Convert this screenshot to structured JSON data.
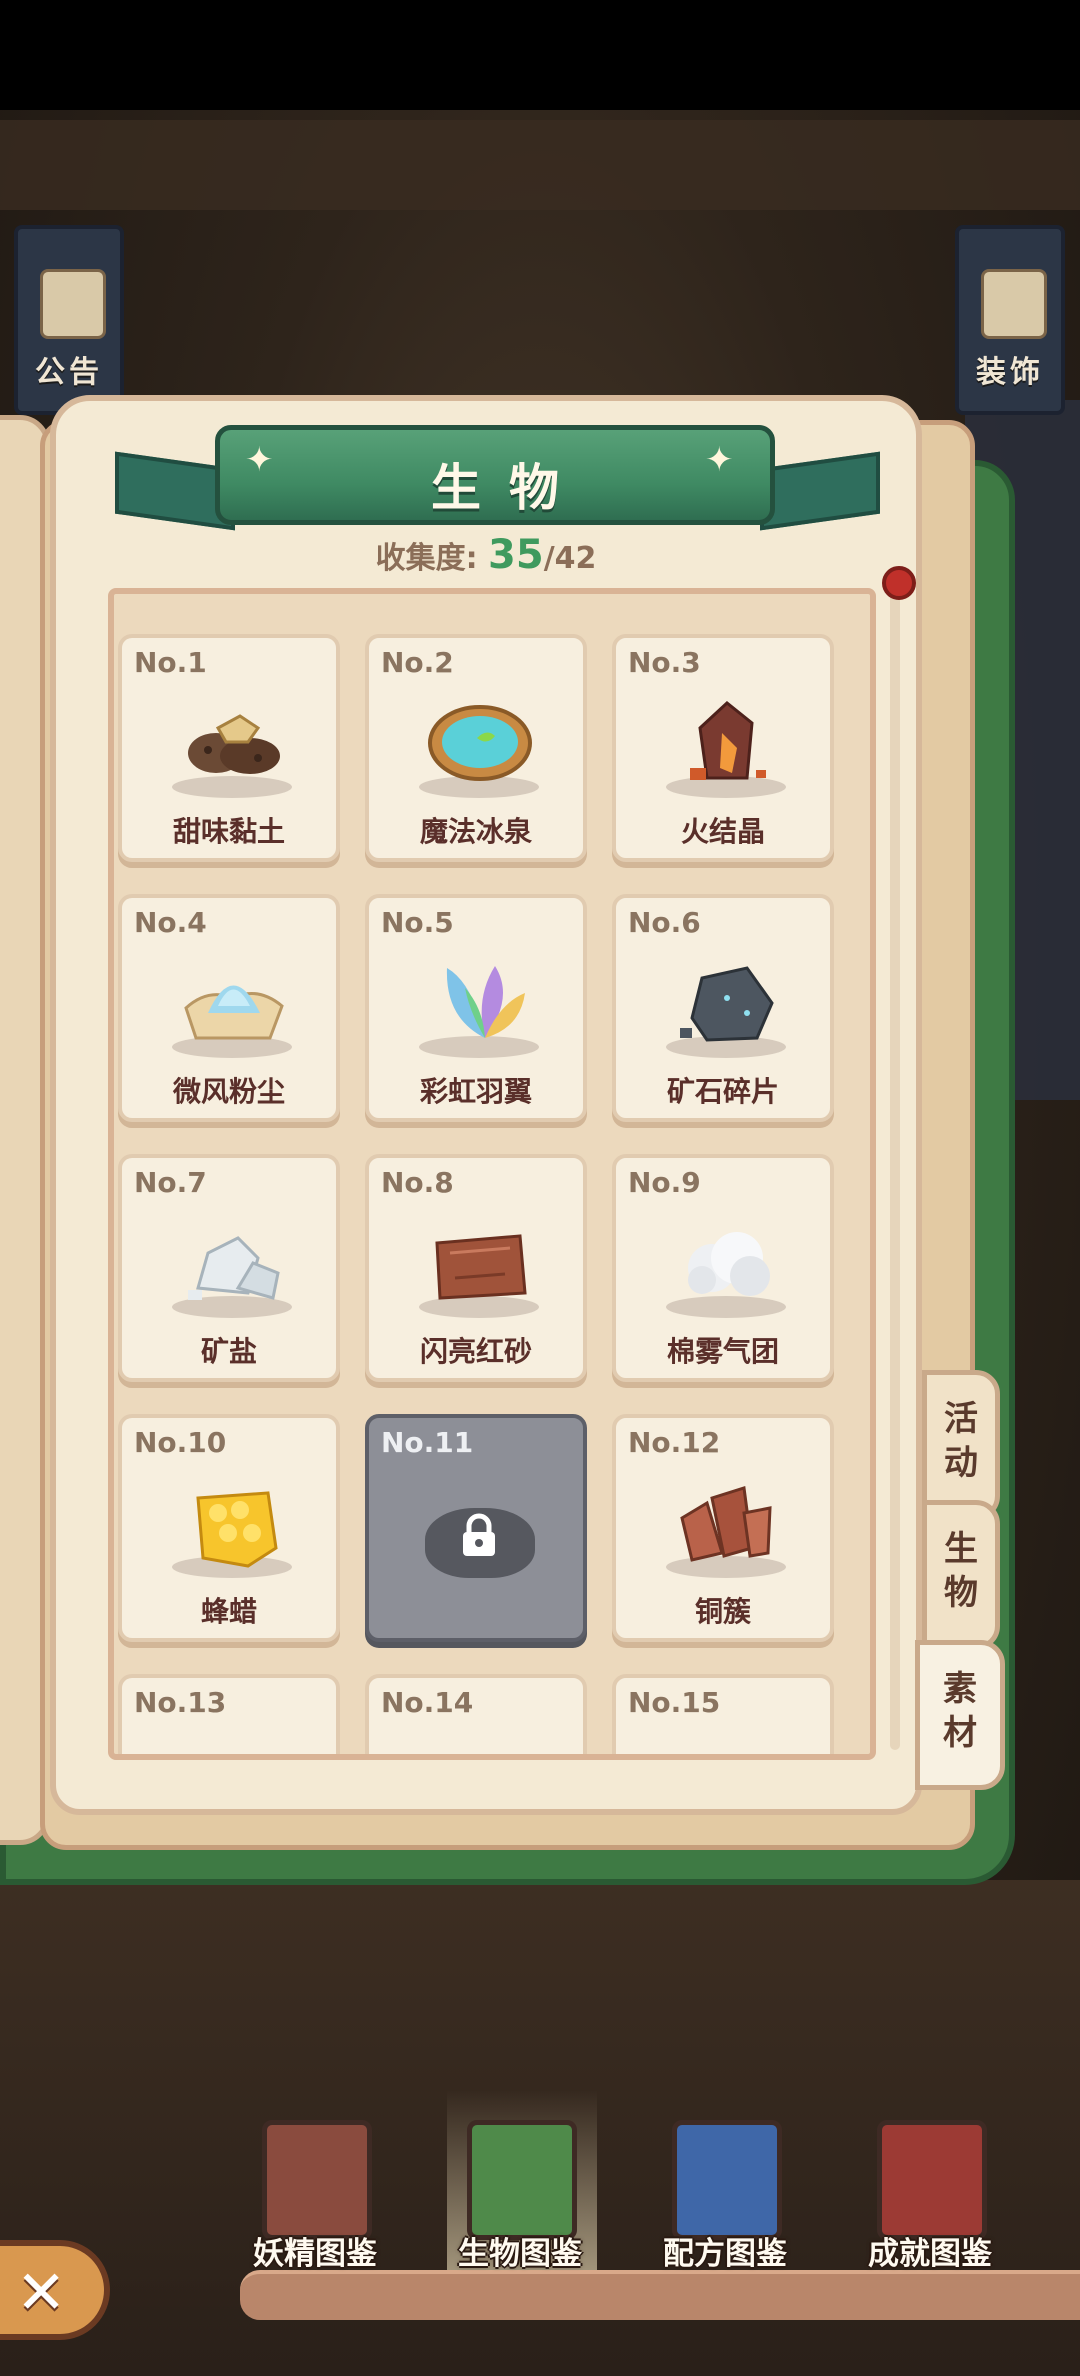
{
  "side_banners": {
    "left_label": "公告",
    "right_label": "装饰"
  },
  "book": {
    "title": "生物",
    "collection": {
      "label": "收集度:",
      "current": "35",
      "total": "/42"
    }
  },
  "cards": [
    {
      "no": "No.1",
      "name": "甜味黏土",
      "icon": "clay-lumps",
      "locked": false
    },
    {
      "no": "No.2",
      "name": "魔法冰泉",
      "icon": "magic-spring-bowl",
      "locked": false
    },
    {
      "no": "No.3",
      "name": "火结晶",
      "icon": "fire-crystal",
      "locked": false
    },
    {
      "no": "No.4",
      "name": "微风粉尘",
      "icon": "breeze-dust",
      "locked": false
    },
    {
      "no": "No.5",
      "name": "彩虹羽翼",
      "icon": "rainbow-wing",
      "locked": false
    },
    {
      "no": "No.6",
      "name": "矿石碎片",
      "icon": "ore-fragment",
      "locked": false
    },
    {
      "no": "No.7",
      "name": "矿盐",
      "icon": "rock-salt",
      "locked": false
    },
    {
      "no": "No.8",
      "name": "闪亮红砂",
      "icon": "red-sand-block",
      "locked": false
    },
    {
      "no": "No.9",
      "name": "棉雾气团",
      "icon": "cotton-cloud",
      "locked": false
    },
    {
      "no": "No.10",
      "name": "蜂蜡",
      "icon": "honeycomb",
      "locked": false
    },
    {
      "no": "No.11",
      "name": "",
      "icon": "lock",
      "locked": true
    },
    {
      "no": "No.12",
      "name": "铜簇",
      "icon": "copper-cluster",
      "locked": false
    },
    {
      "no": "No.13",
      "name": "",
      "icon": "partial",
      "locked": false
    },
    {
      "no": "No.14",
      "name": "",
      "icon": "partial",
      "locked": false
    },
    {
      "no": "No.15",
      "name": "",
      "icon": "partial",
      "locked": false
    }
  ],
  "side_tabs": [
    {
      "label": "活\n动",
      "active": false
    },
    {
      "label": "生\n物",
      "active": false
    },
    {
      "label": "素\n材",
      "active": true
    }
  ],
  "bottom_nav": [
    {
      "label": "妖精图鉴",
      "icon": "fairy-book-icon",
      "active": false
    },
    {
      "label": "生物图鉴",
      "icon": "creature-book-icon",
      "active": true
    },
    {
      "label": "配方图鉴",
      "icon": "recipe-book-icon",
      "active": false
    },
    {
      "label": "成就图鉴",
      "icon": "achievement-book-icon",
      "active": false
    }
  ],
  "close_icon": "close-icon",
  "colors": {
    "accent_green": "#3f9a5e",
    "ribbon": "#4a9570",
    "card_text": "#5a2f2a",
    "book_green": "#3e7a44"
  }
}
